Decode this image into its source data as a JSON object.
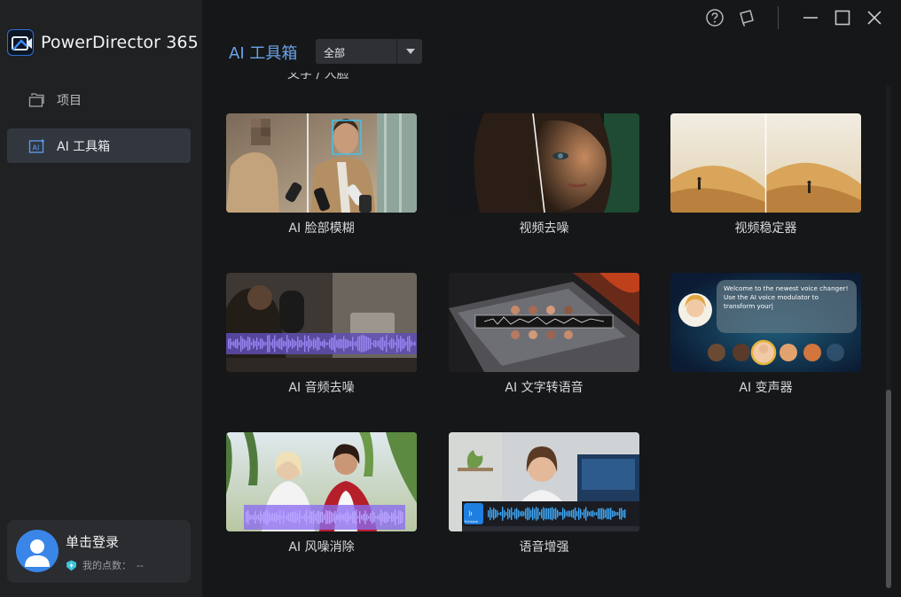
{
  "app": {
    "name": "PowerDirector 365"
  },
  "sidebar": {
    "items": [
      {
        "label": "项目",
        "icon": "folder-icon",
        "active": false
      },
      {
        "label": "AI 工具箱",
        "icon": "ai-toolbox-icon",
        "active": true
      }
    ],
    "user": {
      "login_label": "单击登录",
      "points_label": "我的点数：",
      "points_value": "--"
    }
  },
  "header": {
    "title": "AI 工具箱",
    "filter": {
      "selected": "全部"
    }
  },
  "section": {
    "partial_heading": "文字 / 人脸"
  },
  "tools": [
    {
      "label": "AI 脸部模糊"
    },
    {
      "label": "视频去噪"
    },
    {
      "label": "视频稳定器"
    },
    {
      "label": "AI 音频去噪"
    },
    {
      "label": "AI 文字转语音"
    },
    {
      "label": "AI 变声器"
    },
    {
      "label": "AI 风噪消除"
    },
    {
      "label": "语音增强"
    }
  ],
  "thumbnails": {
    "voice_changer_text": [
      "Welcome to the newest voice changer!",
      "Use the AI voice modulator to",
      "transform your|"
    ],
    "enhance_badge": "Enhance"
  },
  "colors": {
    "accent": "#6aa2e8",
    "sidebar_bg": "#202123",
    "main_bg": "#161718",
    "active_item": "#32373f"
  }
}
